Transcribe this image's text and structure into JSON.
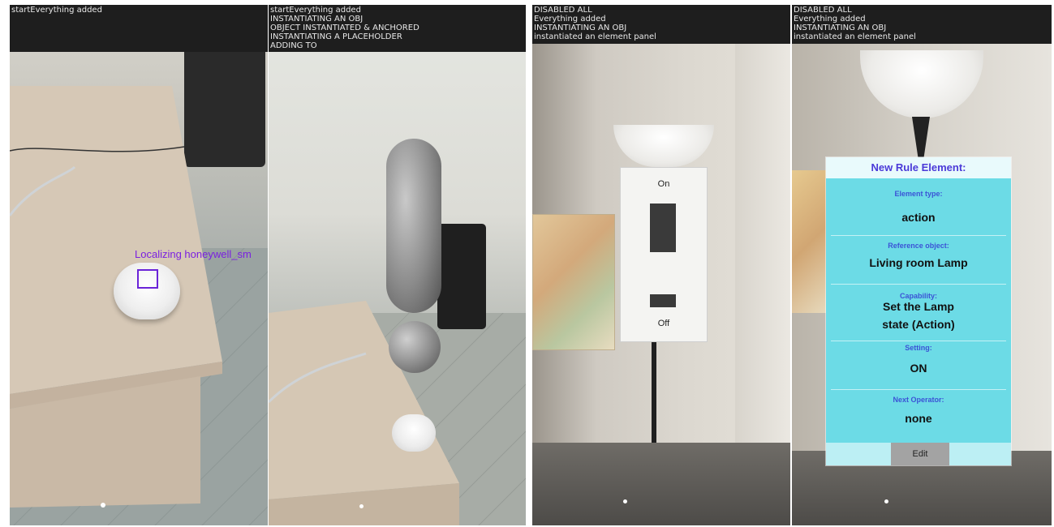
{
  "panels": [
    {
      "log_lines": [
        "startEverything added"
      ],
      "overlay_label": "Localizing honeywell_sm"
    },
    {
      "log_lines": [
        "startEverything added",
        "INSTANTIATING AN OBJ",
        "OBJECT INSTANTIATED & ANCHORED",
        "INSTANTIATING A PLACEHOLDER",
        "ADDING TO"
      ]
    },
    {
      "log_lines": [
        "DISABLED ALL",
        "Everything added",
        "INSTANTIATING AN OBJ",
        "instantiated an element panel"
      ],
      "switch": {
        "on_label": "On",
        "off_label": "Off"
      }
    },
    {
      "log_lines": [
        "DISABLED ALL",
        "Everything added",
        "INSTANTIATING AN OBJ",
        "instantiated an element panel"
      ],
      "rule_element": {
        "title": "New Rule Element:",
        "element_type_label": "Element type:",
        "element_type_value": "action",
        "reference_object_label": "Reference object:",
        "reference_object_value": "Living room Lamp",
        "capability_label": "Capability:",
        "capability_value_line1": "Set the Lamp",
        "capability_value_line2": "state (Action)",
        "setting_label": "Setting:",
        "setting_value": "ON",
        "next_operator_label": "Next Operator:",
        "next_operator_value": "none",
        "edit_label": "Edit"
      }
    }
  ],
  "colors": {
    "localize_accent": "#7a1fe0",
    "rule_card_bg": "#6cdbe6",
    "rule_title_color": "#4b3ad8"
  }
}
